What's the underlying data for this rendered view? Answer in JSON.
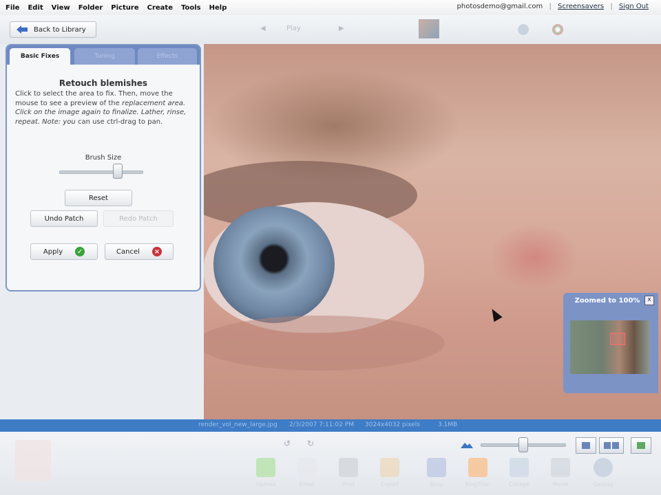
{
  "menu": [
    "File",
    "Edit",
    "View",
    "Folder",
    "Picture",
    "Create",
    "Tools",
    "Help"
  ],
  "account": {
    "email": "photosdemo@gmail.com",
    "screensavers": "Screensavers",
    "sign_out": "Sign Out"
  },
  "toolbar": {
    "back_label": "Back to Library",
    "play_label": "Play"
  },
  "panel": {
    "tabs": [
      "Basic Fixes",
      "Tuning",
      "Effects"
    ],
    "title": "Retouch blemishes",
    "desc_plain": "Click to select the area to fix. Then, move the mouse to see a preview of the",
    "desc_italic": "replacement area. Click on the image again to finalize. Lather, rinse, repeat. Note: you",
    "desc_tail": "can use ctrl-drag to pan.",
    "brush_size_label": "Brush Size",
    "brush_size_value": 0.7,
    "reset_label": "Reset",
    "undo_label": "Undo Patch",
    "redo_label": "Redo Patch",
    "apply_label": "Apply",
    "cancel_label": "Cancel"
  },
  "navigator": {
    "title": "Zoomed to 100%",
    "close": "x"
  },
  "statusbar": [
    "render_vol_new_large.jpg",
    "2/3/2007 7:11:02 PM",
    "3024x4032 pixels",
    "3.1MB"
  ],
  "tray": {
    "zoom_value": 0.5,
    "items": [
      "Upload",
      "Email",
      "Print",
      "Export",
      "Shop",
      "BlogThis!",
      "Collage",
      "Movie",
      "Geotag"
    ]
  },
  "colors": {
    "accent": "#6f89c2",
    "status": "#3f7cc6",
    "apply_icon": "#3aa33a",
    "cancel_icon": "#c8323a"
  }
}
